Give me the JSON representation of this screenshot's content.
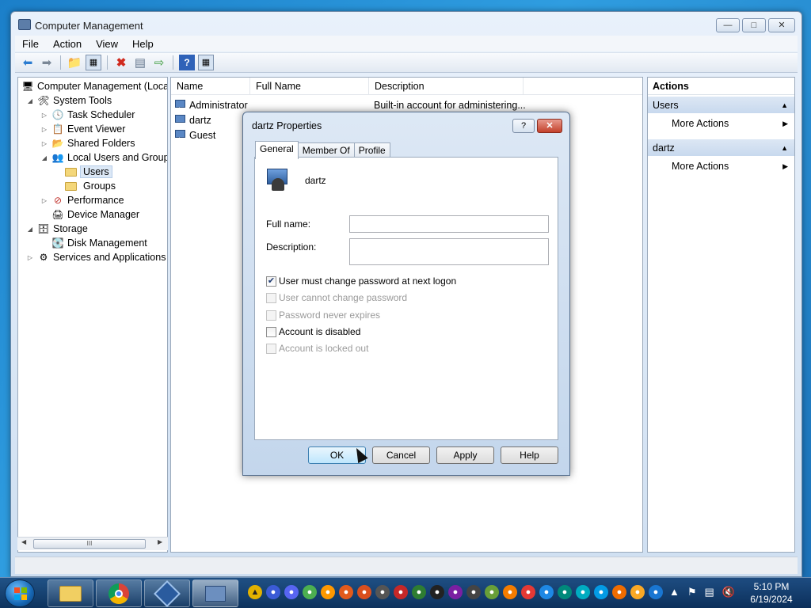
{
  "window": {
    "title": "Computer Management",
    "menu": [
      "File",
      "Action",
      "View",
      "Help"
    ],
    "caption_icons": [
      "minimize-icon",
      "maximize-icon",
      "close-icon"
    ]
  },
  "toolbar": {
    "icons": [
      "back-icon",
      "forward-icon",
      "up-folder-icon",
      "show-hide-tree-icon",
      "delete-icon",
      "properties-icon",
      "export-list-icon",
      "help-icon",
      "action-pane-icon"
    ]
  },
  "tree": {
    "items": [
      {
        "label": "Computer Management (Local",
        "icon": "computer-management-icon",
        "expander": ""
      },
      {
        "label": "System Tools",
        "icon": "system-tools-icon",
        "expander": "expanded"
      },
      {
        "label": "Task Scheduler",
        "icon": "clock-icon",
        "expander": "collapsed"
      },
      {
        "label": "Event Viewer",
        "icon": "event-viewer-icon",
        "expander": "collapsed"
      },
      {
        "label": "Shared Folders",
        "icon": "shared-folder-icon",
        "expander": "collapsed"
      },
      {
        "label": "Local Users and Groups",
        "icon": "users-groups-icon",
        "expander": "expanded"
      },
      {
        "label": "Users",
        "icon": "folder-icon",
        "expander": "",
        "selected": true
      },
      {
        "label": "Groups",
        "icon": "folder-icon",
        "expander": ""
      },
      {
        "label": "Performance",
        "icon": "performance-icon",
        "expander": "collapsed"
      },
      {
        "label": "Device Manager",
        "icon": "device-manager-icon",
        "expander": ""
      },
      {
        "label": "Storage",
        "icon": "storage-icon",
        "expander": "expanded"
      },
      {
        "label": "Disk Management",
        "icon": "disk-icon",
        "expander": ""
      },
      {
        "label": "Services and Applications",
        "icon": "services-icon",
        "expander": "collapsed"
      }
    ],
    "scroll_thumb": "III"
  },
  "list": {
    "columns": [
      "Name",
      "Full Name",
      "Description"
    ],
    "rows": [
      {
        "name": "Administrator",
        "full_name": "",
        "description": "Built-in account for administering..."
      },
      {
        "name": "dartz",
        "full_name": "",
        "description": ""
      },
      {
        "name": "Guest",
        "full_name": "",
        "description": ""
      }
    ]
  },
  "actions": {
    "header": "Actions",
    "sections": [
      {
        "title": "Users",
        "items": [
          "More Actions"
        ]
      },
      {
        "title": "dartz",
        "items": [
          "More Actions"
        ]
      }
    ]
  },
  "dialog": {
    "title": "dartz Properties",
    "help_label": "?",
    "tabs": [
      "General",
      "Member Of",
      "Profile"
    ],
    "active_tab": "General",
    "username": "dartz",
    "full_name_label": "Full name:",
    "full_name_value": "",
    "description_label": "Description:",
    "description_value": "",
    "checkboxes": [
      {
        "label": "User must change password at next logon",
        "checked": true,
        "enabled": true
      },
      {
        "label": "User cannot change password",
        "checked": false,
        "enabled": false
      },
      {
        "label": "Password never expires",
        "checked": false,
        "enabled": false
      },
      {
        "label": "Account is disabled",
        "checked": false,
        "enabled": true
      },
      {
        "label": "Account is locked out",
        "checked": false,
        "enabled": false
      }
    ],
    "buttons": [
      "OK",
      "Cancel",
      "Apply",
      "Help"
    ]
  },
  "taskbar": {
    "pinned": [
      "explorer-icon",
      "chrome-icon",
      "virtualbox-icon",
      "computer-management-icon"
    ],
    "tray_apps": [
      "app-1",
      "app-2",
      "app-3",
      "app-4",
      "app-5",
      "app-6",
      "app-7",
      "app-8",
      "app-9",
      "app-10",
      "app-11",
      "app-12",
      "app-13",
      "app-14",
      "app-15",
      "app-16",
      "app-17",
      "app-18",
      "app-19",
      "app-20",
      "app-21",
      "app-22",
      "app-23",
      "app-24",
      "app-25"
    ],
    "clock_time": "5:10 PM",
    "clock_date": "6/19/2024"
  }
}
